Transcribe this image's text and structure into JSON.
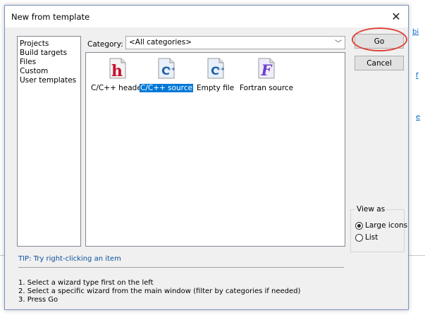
{
  "background": {
    "links": [
      "bi",
      "f",
      "e"
    ]
  },
  "dialog": {
    "title": "New from template",
    "close_icon": "close-icon"
  },
  "sidebar": {
    "items": [
      {
        "label": "Projects"
      },
      {
        "label": "Build targets"
      },
      {
        "label": "Files"
      },
      {
        "label": "Custom"
      },
      {
        "label": "User templates"
      }
    ]
  },
  "category": {
    "label": "Category:",
    "selected": "<All categories>"
  },
  "templates": [
    {
      "label": "C/C++ header",
      "icon": "h-header-icon",
      "selected": false
    },
    {
      "label": "C/C++ source",
      "icon": "cpp-source-icon",
      "selected": true
    },
    {
      "label": "Empty file",
      "icon": "empty-file-icon",
      "selected": false
    },
    {
      "label": "Fortran source",
      "icon": "fortran-source-icon",
      "selected": false
    }
  ],
  "buttons": {
    "go": "Go",
    "cancel": "Cancel"
  },
  "view_as": {
    "legend": "View as",
    "options": [
      {
        "label": "Large icons",
        "checked": true
      },
      {
        "label": "List",
        "checked": false
      }
    ]
  },
  "tip": "TIP: Try right-clicking an item",
  "steps": [
    "1. Select a wizard type first on the left",
    "2. Select a specific wizard from the main window (filter by categories if needed)",
    "3. Press Go"
  ],
  "colors": {
    "accent": "#0078d7",
    "highlight_ring": "#e0433a",
    "tip_text": "#0a4f9c"
  }
}
